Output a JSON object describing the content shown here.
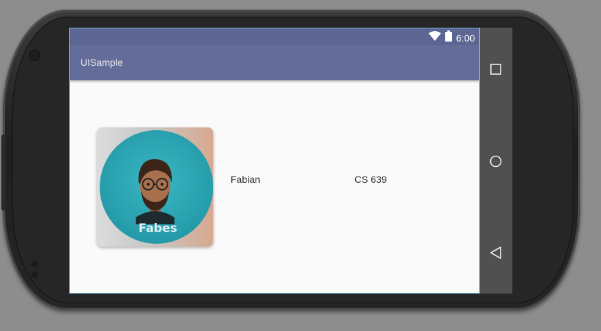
{
  "status_bar": {
    "time": "6:00",
    "icons": [
      "wifi-icon",
      "battery-icon"
    ]
  },
  "app_bar": {
    "title": "UISample"
  },
  "list_item": {
    "avatar_label": "Fabes",
    "name": "Fabian",
    "course": "CS 639"
  },
  "nav_bar": {
    "buttons": [
      "recents-square-icon",
      "home-circle-icon",
      "back-triangle-icon"
    ]
  },
  "colors": {
    "status_bar": "#5d6593",
    "app_bar": "#646c99",
    "avatar_bg": "#2fa8b3",
    "nav_bar": "#505050"
  }
}
